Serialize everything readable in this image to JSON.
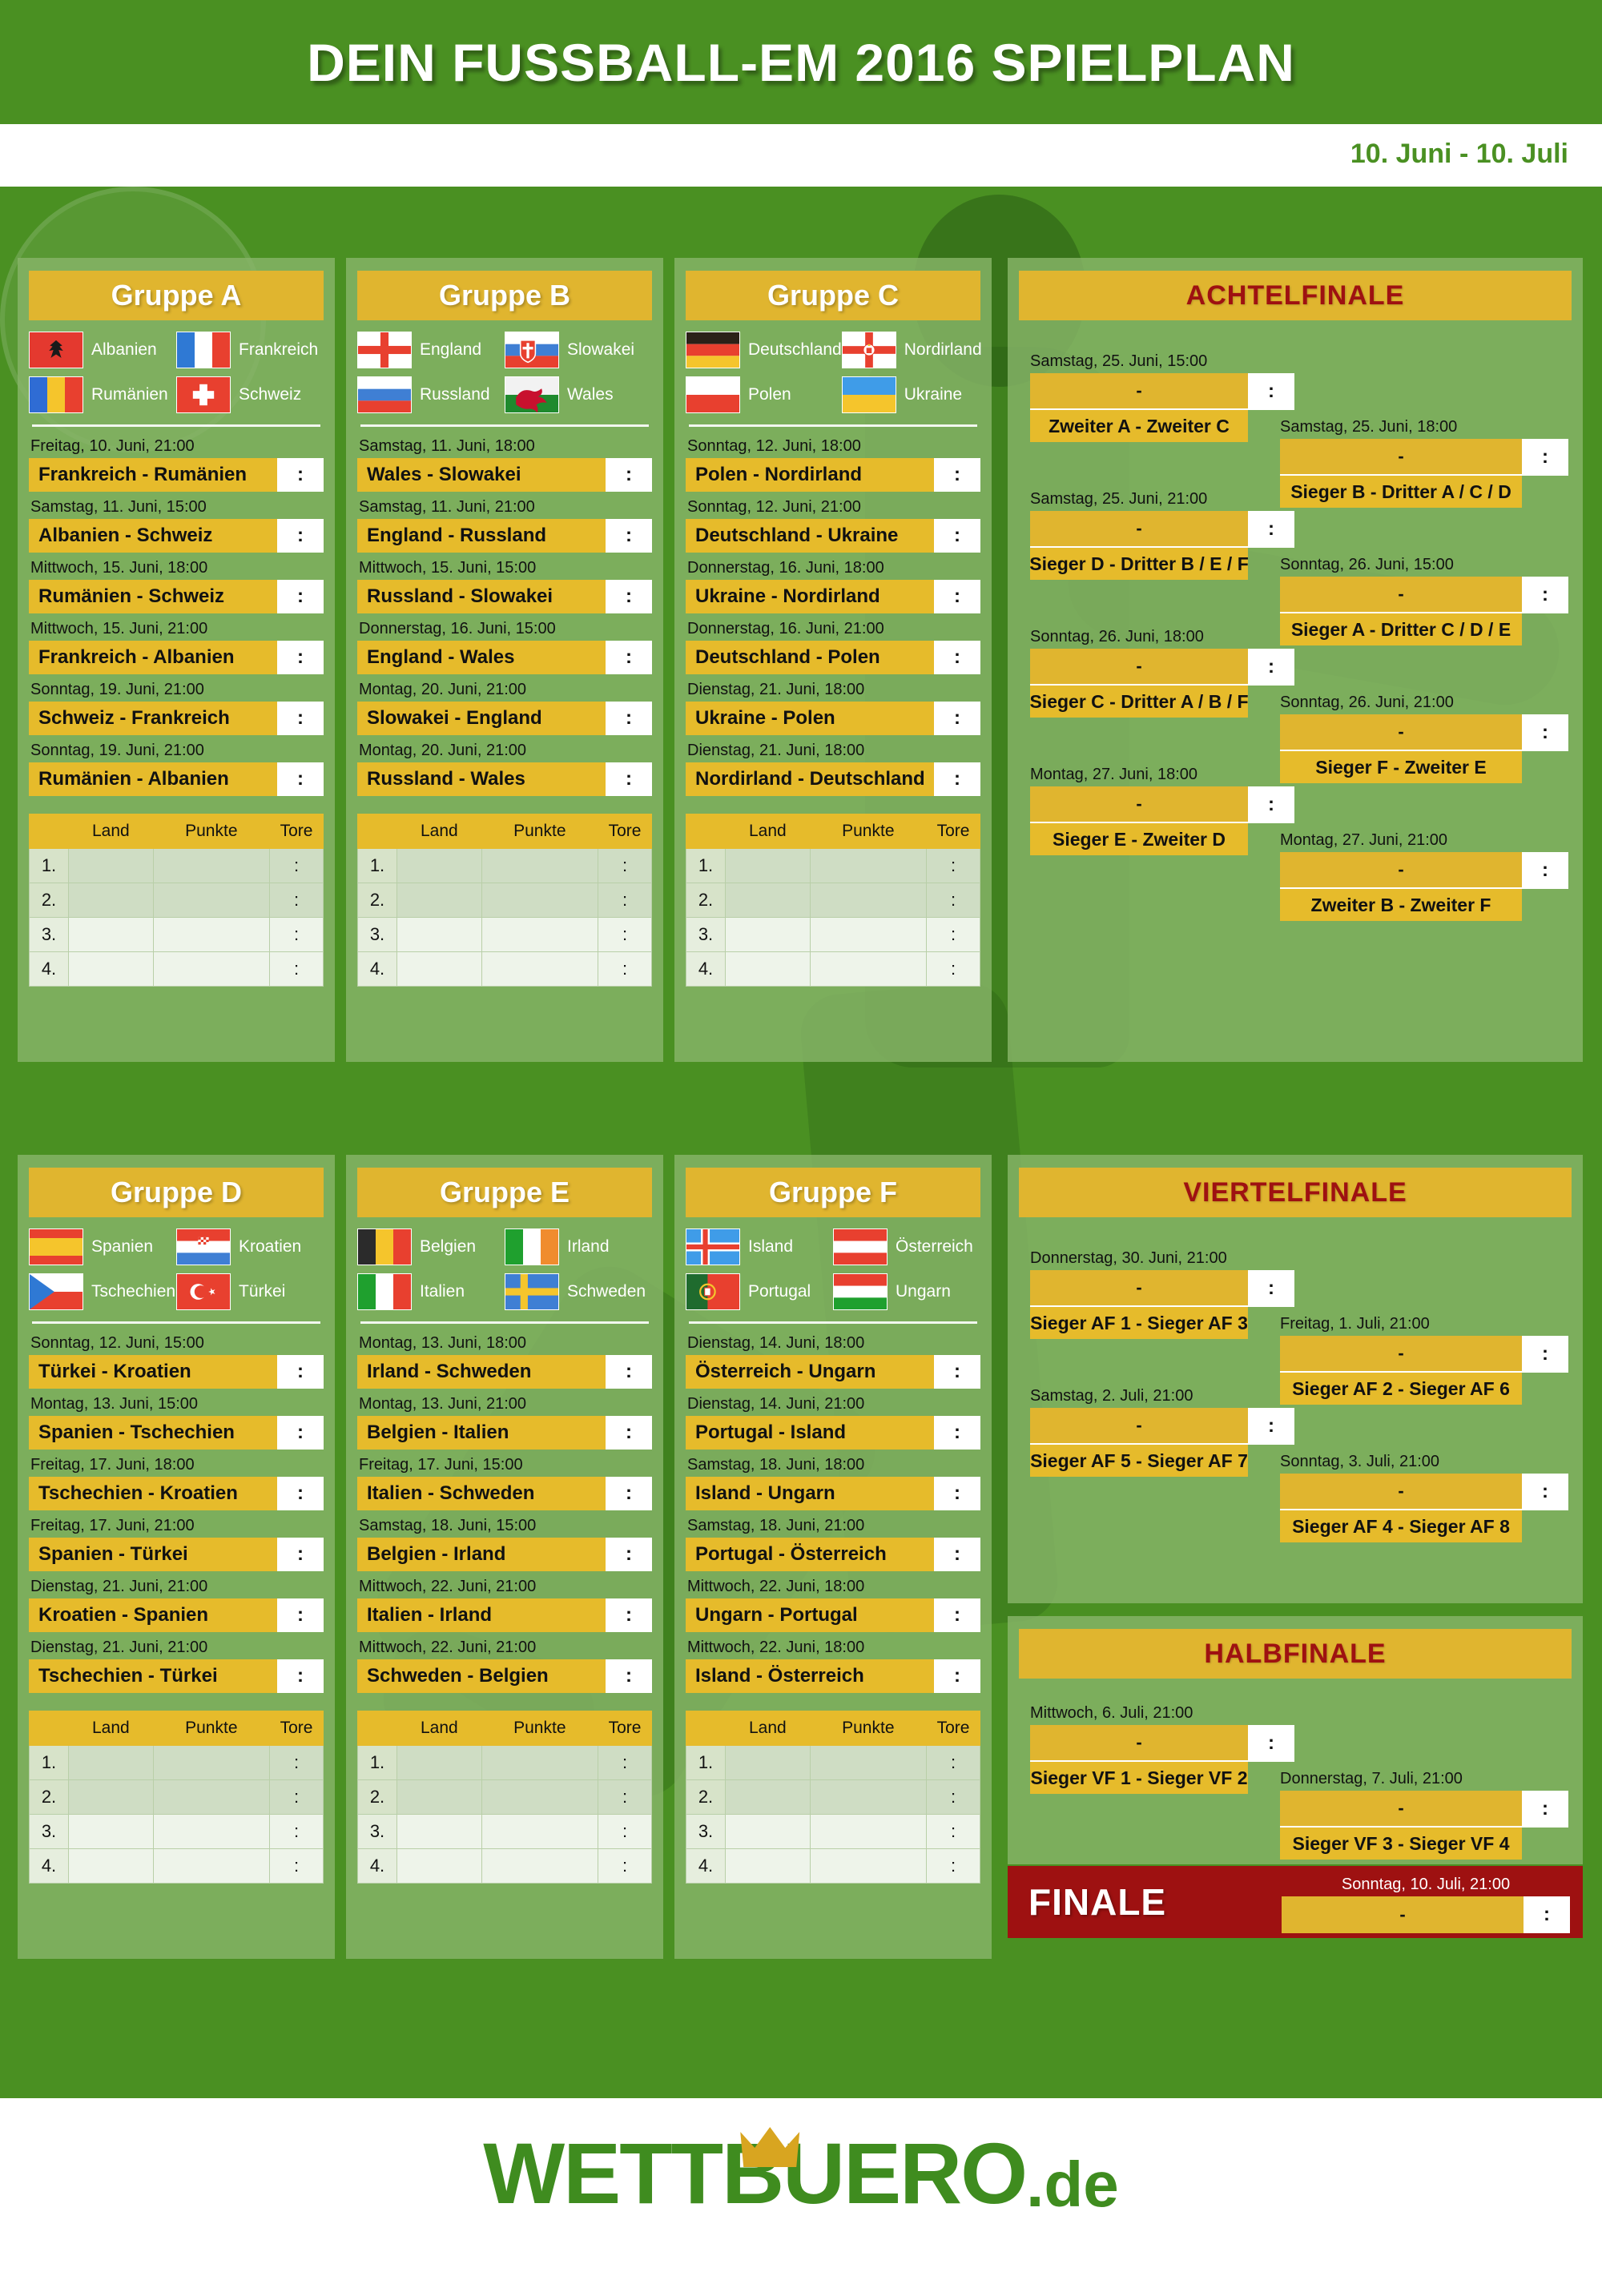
{
  "header": {
    "title": "DEIN FUSSBALL-EM 2016 SPIELPLAN",
    "date_range": "10. Juni - 10. Juli"
  },
  "colors": {
    "pitch_green": "#4a9022",
    "panel_green": "#87b469",
    "gold": "#e6bb2b",
    "gold_dark": "#e0b52f",
    "ko_red": "#9e1111",
    "brand_green": "#3f8c1f"
  },
  "table_headers": {
    "rank": "",
    "land": "Land",
    "punkte": "Punkte",
    "tore": "Tore"
  },
  "table_rows": [
    "1.",
    "2.",
    "3.",
    "4."
  ],
  "score_placeholder": ":",
  "ko_blank_placeholder": "-",
  "groups": [
    {
      "id": "a",
      "title": "Gruppe A",
      "teams": [
        {
          "name": "Albanien",
          "flag": "albania-flag"
        },
        {
          "name": "Frankreich",
          "flag": "france-flag"
        },
        {
          "name": "Rumänien",
          "flag": "romania-flag"
        },
        {
          "name": "Schweiz",
          "flag": "switzerland-flag"
        }
      ],
      "matches": [
        {
          "date": "Freitag, 10. Juni, 21:00",
          "teams": "Frankreich - Rumänien"
        },
        {
          "date": "Samstag, 11. Juni, 15:00",
          "teams": "Albanien - Schweiz"
        },
        {
          "date": "Mittwoch, 15. Juni, 18:00",
          "teams": "Rumänien - Schweiz"
        },
        {
          "date": "Mittwoch, 15. Juni, 21:00",
          "teams": "Frankreich - Albanien"
        },
        {
          "date": "Sonntag, 19. Juni, 21:00",
          "teams": "Schweiz - Frankreich"
        },
        {
          "date": "Sonntag, 19. Juni, 21:00",
          "teams": "Rumänien - Albanien"
        }
      ]
    },
    {
      "id": "b",
      "title": "Gruppe B",
      "teams": [
        {
          "name": "England",
          "flag": "england-flag"
        },
        {
          "name": "Slowakei",
          "flag": "slovakia-flag"
        },
        {
          "name": "Russland",
          "flag": "russia-flag"
        },
        {
          "name": "Wales",
          "flag": "wales-flag"
        }
      ],
      "matches": [
        {
          "date": "Samstag, 11. Juni, 18:00",
          "teams": "Wales - Slowakei"
        },
        {
          "date": "Samstag, 11. Juni, 21:00",
          "teams": "England - Russland"
        },
        {
          "date": "Mittwoch, 15. Juni, 15:00",
          "teams": "Russland - Slowakei"
        },
        {
          "date": "Donnerstag, 16. Juni, 15:00",
          "teams": "England - Wales"
        },
        {
          "date": "Montag, 20. Juni, 21:00",
          "teams": "Slowakei - England"
        },
        {
          "date": "Montag, 20. Juni, 21:00",
          "teams": "Russland - Wales"
        }
      ]
    },
    {
      "id": "c",
      "title": "Gruppe C",
      "teams": [
        {
          "name": "Deutschland",
          "flag": "germany-flag"
        },
        {
          "name": "Nordirland",
          "flag": "northern-ireland-flag"
        },
        {
          "name": "Polen",
          "flag": "poland-flag"
        },
        {
          "name": "Ukraine",
          "flag": "ukraine-flag"
        }
      ],
      "matches": [
        {
          "date": "Sonntag, 12. Juni, 18:00",
          "teams": "Polen - Nordirland"
        },
        {
          "date": "Sonntag, 12. Juni, 21:00",
          "teams": "Deutschland - Ukraine"
        },
        {
          "date": "Donnerstag, 16. Juni, 18:00",
          "teams": "Ukraine - Nordirland"
        },
        {
          "date": "Donnerstag, 16. Juni, 21:00",
          "teams": "Deutschland - Polen"
        },
        {
          "date": "Dienstag, 21. Juni, 18:00",
          "teams": "Ukraine - Polen"
        },
        {
          "date": "Dienstag, 21. Juni, 18:00",
          "teams": "Nordirland - Deutschland"
        }
      ]
    },
    {
      "id": "d",
      "title": "Gruppe D",
      "teams": [
        {
          "name": "Spanien",
          "flag": "spain-flag"
        },
        {
          "name": "Kroatien",
          "flag": "croatia-flag"
        },
        {
          "name": "Tschechien",
          "flag": "czech-republic-flag"
        },
        {
          "name": "Türkei",
          "flag": "turkey-flag"
        }
      ],
      "matches": [
        {
          "date": "Sonntag, 12. Juni, 15:00",
          "teams": "Türkei - Kroatien"
        },
        {
          "date": "Montag, 13. Juni, 15:00",
          "teams": "Spanien - Tschechien"
        },
        {
          "date": "Freitag, 17. Juni, 18:00",
          "teams": "Tschechien - Kroatien"
        },
        {
          "date": "Freitag, 17. Juni, 21:00",
          "teams": "Spanien - Türkei"
        },
        {
          "date": "Dienstag, 21. Juni, 21:00",
          "teams": "Kroatien - Spanien"
        },
        {
          "date": "Dienstag, 21. Juni, 21:00",
          "teams": "Tschechien - Türkei"
        }
      ]
    },
    {
      "id": "e",
      "title": "Gruppe E",
      "teams": [
        {
          "name": "Belgien",
          "flag": "belgium-flag"
        },
        {
          "name": "Irland",
          "flag": "ireland-flag"
        },
        {
          "name": "Italien",
          "flag": "italy-flag"
        },
        {
          "name": "Schweden",
          "flag": "sweden-flag"
        }
      ],
      "matches": [
        {
          "date": "Montag, 13. Juni, 18:00",
          "teams": "Irland - Schweden"
        },
        {
          "date": "Montag, 13. Juni, 21:00",
          "teams": "Belgien - Italien"
        },
        {
          "date": "Freitag, 17. Juni, 15:00",
          "teams": "Italien - Schweden"
        },
        {
          "date": "Samstag, 18. Juni, 15:00",
          "teams": "Belgien - Irland"
        },
        {
          "date": "Mittwoch, 22. Juni, 21:00",
          "teams": "Italien - Irland"
        },
        {
          "date": "Mittwoch, 22. Juni, 21:00",
          "teams": "Schweden - Belgien"
        }
      ]
    },
    {
      "id": "f",
      "title": "Gruppe F",
      "teams": [
        {
          "name": "Island",
          "flag": "iceland-flag"
        },
        {
          "name": "Österreich",
          "flag": "austria-flag"
        },
        {
          "name": "Portugal",
          "flag": "portugal-flag"
        },
        {
          "name": "Ungarn",
          "flag": "hungary-flag"
        }
      ],
      "matches": [
        {
          "date": "Dienstag, 14. Juni, 18:00",
          "teams": "Österreich - Ungarn"
        },
        {
          "date": "Dienstag, 14. Juni, 21:00",
          "teams": "Portugal - Island"
        },
        {
          "date": "Samstag, 18. Juni, 18:00",
          "teams": "Island - Ungarn"
        },
        {
          "date": "Samstag, 18. Juni, 21:00",
          "teams": "Portugal - Österreich"
        },
        {
          "date": "Mittwoch, 22. Juni, 18:00",
          "teams": "Ungarn - Portugal"
        },
        {
          "date": "Mittwoch, 22. Juni, 18:00",
          "teams": "Island - Österreich"
        }
      ]
    }
  ],
  "achtelfinale": {
    "title": "ACHTELFINALE",
    "matches": [
      {
        "date": "Samstag, 25. Juni, 15:00",
        "label": "Zweiter A - Zweiter C"
      },
      {
        "date": "Samstag, 25. Juni, 18:00",
        "label": "Sieger B - Dritter A / C / D"
      },
      {
        "date": "Samstag, 25. Juni, 21:00",
        "label": "Sieger D - Dritter B / E / F"
      },
      {
        "date": "Sonntag, 26. Juni, 15:00",
        "label": "Sieger A - Dritter C / D / E"
      },
      {
        "date": "Sonntag, 26. Juni, 18:00",
        "label": "Sieger C - Dritter A / B / F"
      },
      {
        "date": "Sonntag, 26. Juni, 21:00",
        "label": "Sieger F - Zweiter E"
      },
      {
        "date": "Montag, 27. Juni, 18:00",
        "label": "Sieger E - Zweiter D"
      },
      {
        "date": "Montag, 27. Juni, 21:00",
        "label": "Zweiter B - Zweiter F"
      }
    ]
  },
  "viertelfinale": {
    "title": "VIERTELFINALE",
    "matches": [
      {
        "date": "Donnerstag, 30. Juni, 21:00",
        "label": "Sieger AF 1 - Sieger AF 3"
      },
      {
        "date": "Freitag, 1. Juli, 21:00",
        "label": "Sieger AF 2 - Sieger AF 6"
      },
      {
        "date": "Samstag, 2. Juli, 21:00",
        "label": "Sieger AF 5 - Sieger AF 7"
      },
      {
        "date": "Sonntag, 3. Juli, 21:00",
        "label": "Sieger AF 4 - Sieger AF 8"
      }
    ]
  },
  "halbfinale": {
    "title": "HALBFINALE",
    "matches": [
      {
        "date": "Mittwoch, 6. Juli, 21:00",
        "label": "Sieger VF 1 - Sieger VF 2"
      },
      {
        "date": "Donnerstag, 7. Juli, 21:00",
        "label": "Sieger VF 3 - Sieger VF 4"
      }
    ]
  },
  "finale": {
    "title": "FINALE",
    "date": "Sonntag, 10. Juli, 21:00"
  },
  "footer": {
    "logo_text": "WETTBUERO",
    "logo_tld": ".de"
  }
}
